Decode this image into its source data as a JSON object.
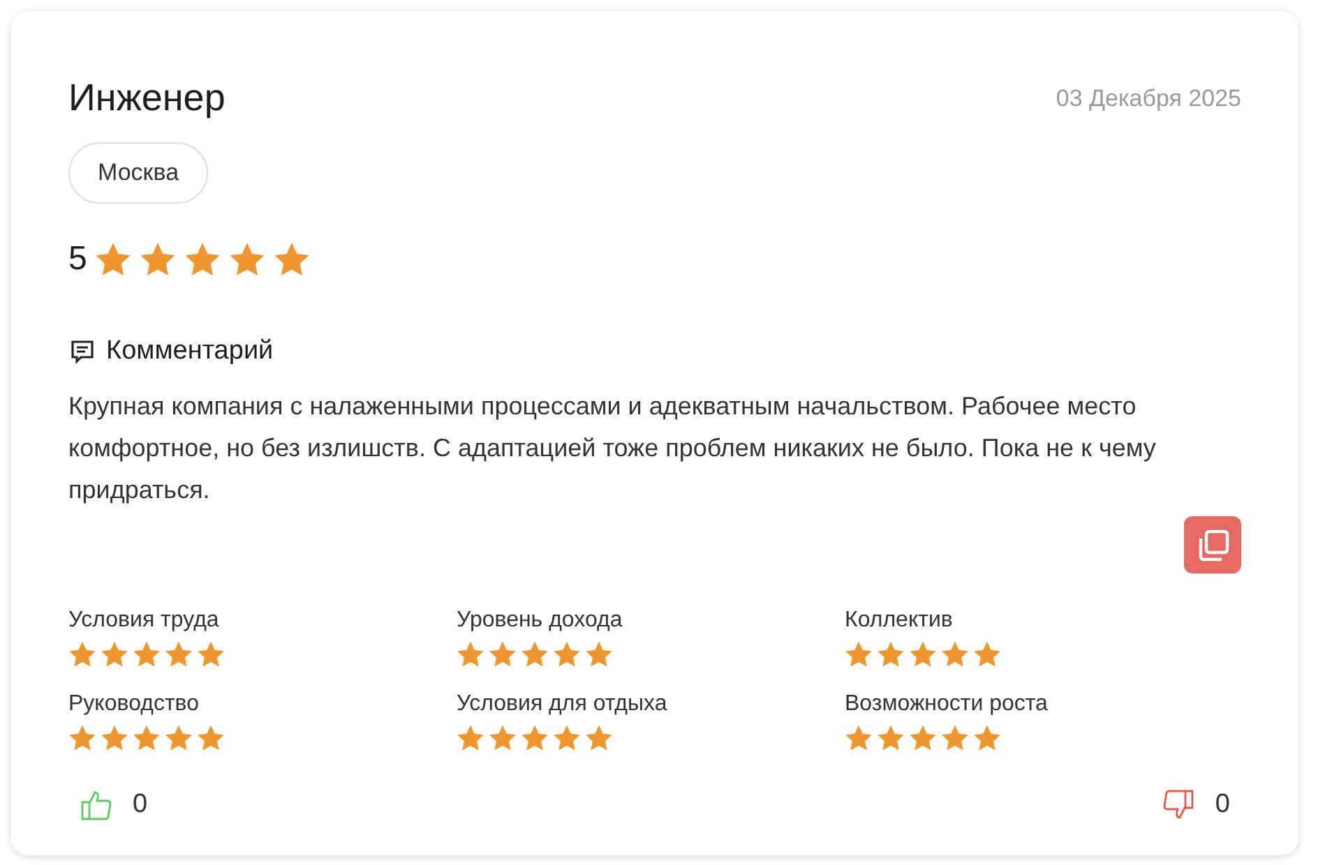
{
  "review": {
    "title": "Инженер",
    "date": "03 Декабря 2025",
    "city": "Москва",
    "rating": "5",
    "stars": 5,
    "comment_label": "Комментарий",
    "comment": "Крупная компания с налаженными процессами и адекватным начальством. Рабочее место комфортное, но без излишств. С адаптацией тоже проблем никаких не было. Пока не к чему придраться.",
    "categories": [
      {
        "label": "Условия труда",
        "stars": 5
      },
      {
        "label": "Уровень дохода",
        "stars": 5
      },
      {
        "label": "Коллектив",
        "stars": 5
      },
      {
        "label": "Руководство",
        "stars": 5
      },
      {
        "label": "Условия для отдыха",
        "stars": 5
      },
      {
        "label": "Возможности роста",
        "stars": 5
      }
    ],
    "likes": "0",
    "dislikes": "0"
  }
}
